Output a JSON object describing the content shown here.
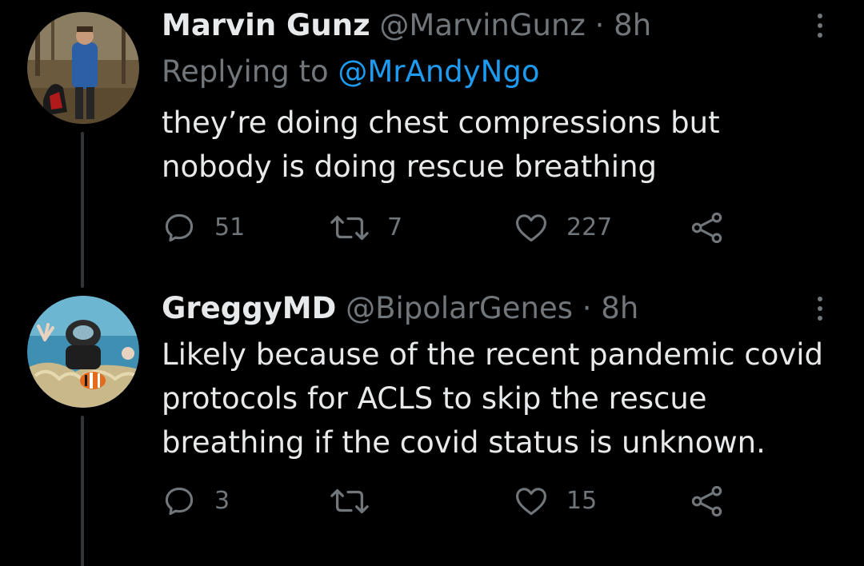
{
  "tweets": [
    {
      "display_name": "Marvin Gunz",
      "handle": "@MarvinGunz",
      "separator": "·",
      "time": "8h",
      "replying_label": "Replying to",
      "replying_to": "@MrAndyNgo",
      "text": "they’re doing chest compressions but\nnobody is doing rescue breathing",
      "reply_count": "51",
      "retweet_count": "7",
      "like_count": "227"
    },
    {
      "display_name": "GreggyMD",
      "handle": "@BipolarGenes",
      "separator": "·",
      "time": "8h",
      "text": "Likely because of the recent pandemic covid\nprotocols for ACLS to skip the rescue\nbreathing if the covid status is unknown.",
      "reply_count": "3",
      "retweet_count": "",
      "like_count": "15"
    }
  ],
  "icons": {
    "reply": "reply-icon",
    "retweet": "retweet-icon",
    "like": "heart-icon",
    "share": "share-icon",
    "more": "more-icon"
  },
  "colors": {
    "background": "#000000",
    "text": "#e7e9ea",
    "secondary": "#71767b",
    "link": "#1d9bf0",
    "thread_line": "#333639"
  }
}
